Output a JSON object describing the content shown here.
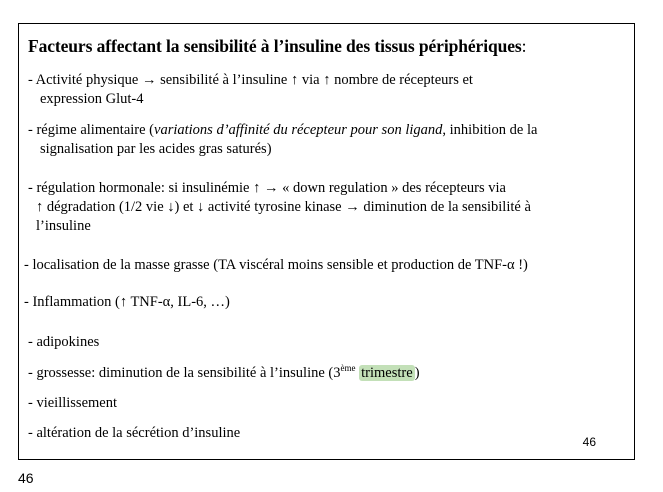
{
  "title": {
    "text": "Facteurs affectant la sensibilité à l’insuline des tissus périphériques",
    "colon": ":"
  },
  "items": [
    {
      "line1": "-  Activité physique → sensibilité à l’insuline ↑  via ↑ nombre de récepteurs et",
      "line2": "expression Glut-4"
    },
    {
      "pre": "-  régime alimentaire (",
      "italic": "variations d’affinité du récepteur pour son ligand",
      "post": ", inhibition de la",
      "line2": "signalisation par les acides gras saturés)"
    },
    {
      "line1": "-   régulation hormonale: si insulinémie ↑ → « down regulation » des récepteurs via",
      "line2": "↑ dégradation (1/2 vie ↓) et ↓ activité tyrosine kinase → diminution de la sensibilité à",
      "line3": "l’insuline"
    },
    {
      "line1": "- localisation de la masse grasse (TA viscéral moins sensible et production de TNF-α !)"
    },
    {
      "line1": "- Inflammation (↑ TNF-α, IL-6, …)"
    },
    {
      "line1": "- adipokines"
    },
    {
      "pre": "- grossesse: diminution de la sensibilité à l’insuline (3",
      "sup": "ème",
      "highlight": "trimestre",
      "post": ")"
    },
    {
      "line1": "- vieillissement"
    },
    {
      "line1": "- altération de la sécrétion d’insuline"
    }
  ],
  "slide_number": "46",
  "page_number": "46"
}
